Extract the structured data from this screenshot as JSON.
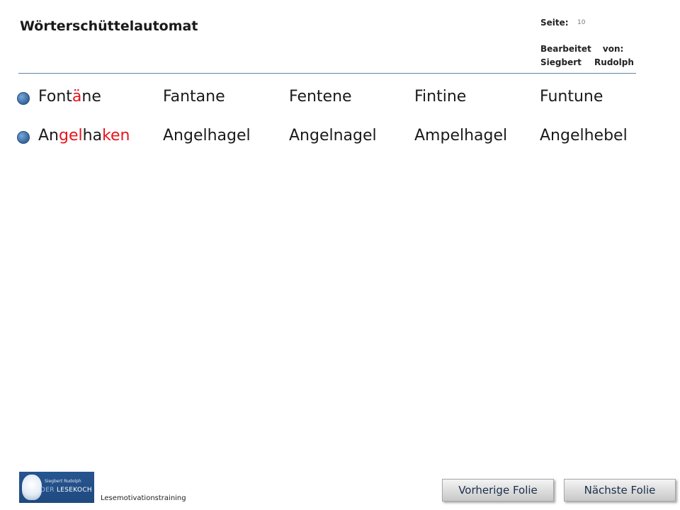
{
  "header": {
    "title": "Wörterschüttelautomat",
    "page_label": "Seite:",
    "page_number": "10",
    "edited_by": "Bearbeitet von:",
    "author": "Siegbert Rudolph"
  },
  "rows": [
    {
      "target": [
        {
          "text": "Font",
          "hl": false
        },
        {
          "text": "ä",
          "hl": true
        },
        {
          "text": "ne",
          "hl": false
        }
      ],
      "variants": [
        "Fantane",
        "Fentene",
        "Fintine",
        "Funtune"
      ]
    },
    {
      "target": [
        {
          "text": "An",
          "hl": false
        },
        {
          "text": "gel",
          "hl": true
        },
        {
          "text": "ha",
          "hl": false
        },
        {
          "text": "ken",
          "hl": true
        }
      ],
      "variants": [
        "Angelhagel",
        "Angelnagel",
        "Ampelhagel",
        "Angelhebel"
      ]
    }
  ],
  "footer": {
    "logo_small": "Siegbert Rudolph",
    "logo_big_prefix": "DER",
    "logo_big": "LESEKOCH",
    "text": "Lesemotivationstraining",
    "prev_button": "Vorherige Folie",
    "next_button": "Nächste Folie"
  },
  "colors": {
    "highlight": "#e8141b",
    "accent": "#3c6fa6"
  }
}
